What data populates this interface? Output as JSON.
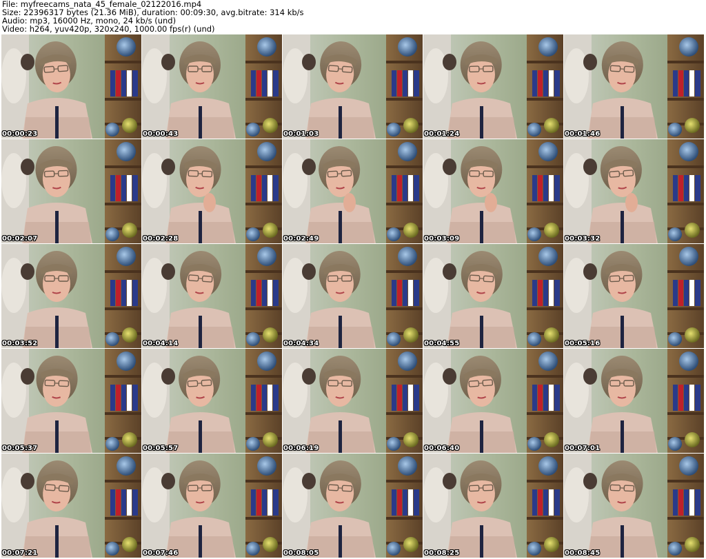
{
  "header": {
    "file_line": "File: myfreecams_nata_45_female_02122016.mp4",
    "size_line": "Size: 22396317 bytes (21.36 MiB), duration: 00:09:30, avg.bitrate: 314 kb/s",
    "audio_line": "Audio: mp3, 16000 Hz, mono, 24 kb/s (und)",
    "video_line": "Video: h264, yuv420p, 320x240, 1000.00 fps(r) (und)"
  },
  "thumbnails": [
    {
      "time": "00:00:23"
    },
    {
      "time": "00:00:43"
    },
    {
      "time": "00:01:03"
    },
    {
      "time": "00:01:24"
    },
    {
      "time": "00:01:46"
    },
    {
      "time": "00:02:07"
    },
    {
      "time": "00:02:28"
    },
    {
      "time": "00:02:49"
    },
    {
      "time": "00:03:09"
    },
    {
      "time": "00:03:32"
    },
    {
      "time": "00:03:52"
    },
    {
      "time": "00:04:14"
    },
    {
      "time": "00:04:34"
    },
    {
      "time": "00:04:55"
    },
    {
      "time": "00:05:16"
    },
    {
      "time": "00:05:37"
    },
    {
      "time": "00:05:57"
    },
    {
      "time": "00:06:19"
    },
    {
      "time": "00:06:40"
    },
    {
      "time": "00:07:01"
    },
    {
      "time": "00:07:21"
    },
    {
      "time": "00:07:46"
    },
    {
      "time": "00:08:05"
    },
    {
      "time": "00:08:25"
    },
    {
      "time": "00:08:45"
    }
  ],
  "colors": {
    "background": "#ffffff",
    "timestamp_text": "#ffffff",
    "timestamp_outline": "#000000"
  }
}
